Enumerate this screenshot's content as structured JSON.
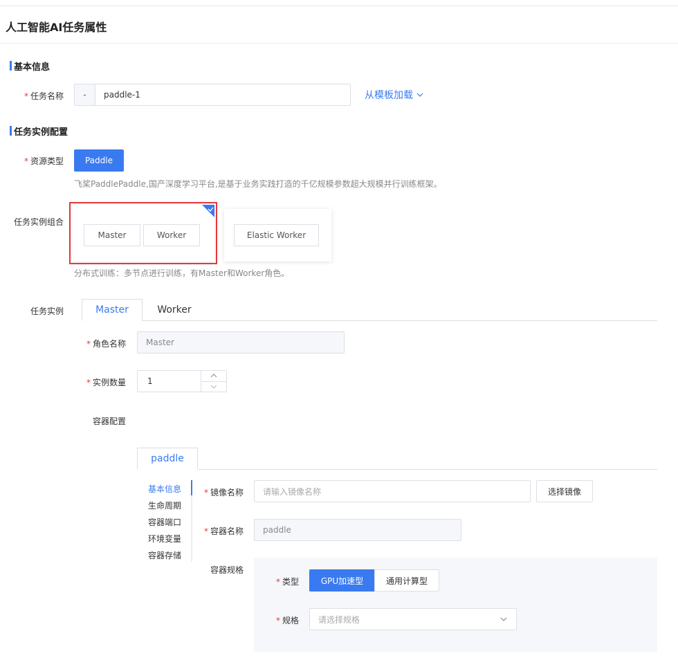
{
  "page": {
    "title": "人工智能AI任务属性"
  },
  "basic": {
    "section_title": "基本信息",
    "task_name_label": "任务名称",
    "task_name_prefix": "-",
    "task_name_value": "paddle-1",
    "load_template_label": "从模板加载"
  },
  "instance_config": {
    "section_title": "任务实例配置",
    "resource_type_label": "资源类型",
    "resource_type_value": "Paddle",
    "resource_desc": "飞桨PaddlePaddle,国产深度学习平台,是基于业务实践打造的千亿规模参数超大规模并行训练框架。",
    "combo_label": "任务实例组合",
    "combos": [
      {
        "roles": [
          "Master",
          "Worker"
        ],
        "selected": true
      },
      {
        "roles": [
          "Elastic Worker"
        ],
        "selected": false
      }
    ],
    "combo_desc": "分布式训练：多节点进行训练，有Master和Worker角色。",
    "highlight_color": "#e4393c"
  },
  "task_instance": {
    "label": "任务实例",
    "tabs": [
      "Master",
      "Worker"
    ],
    "active_tab": "Master",
    "role_name_label": "角色名称",
    "role_name_value": "Master",
    "count_label": "实例数量",
    "count_value": "1",
    "container_config_label": "容器配置"
  },
  "container": {
    "tab_label": "paddle",
    "side_nav": [
      "基本信息",
      "生命周期",
      "容器端口",
      "环境变量",
      "容器存储"
    ],
    "active_nav": "基本信息",
    "image_label": "镜像名称",
    "image_placeholder": "请输入镜像名称",
    "select_image_button": "选择镜像",
    "container_name_label": "容器名称",
    "container_name_value": "paddle",
    "spec_section_label": "容器规格",
    "type_label": "类型",
    "type_options": [
      "GPU加速型",
      "通用计算型"
    ],
    "type_selected": "GPU加速型",
    "spec_label": "规格",
    "spec_placeholder": "请选择规格"
  },
  "colors": {
    "accent": "#3a7af0",
    "required": "#e4393c"
  }
}
